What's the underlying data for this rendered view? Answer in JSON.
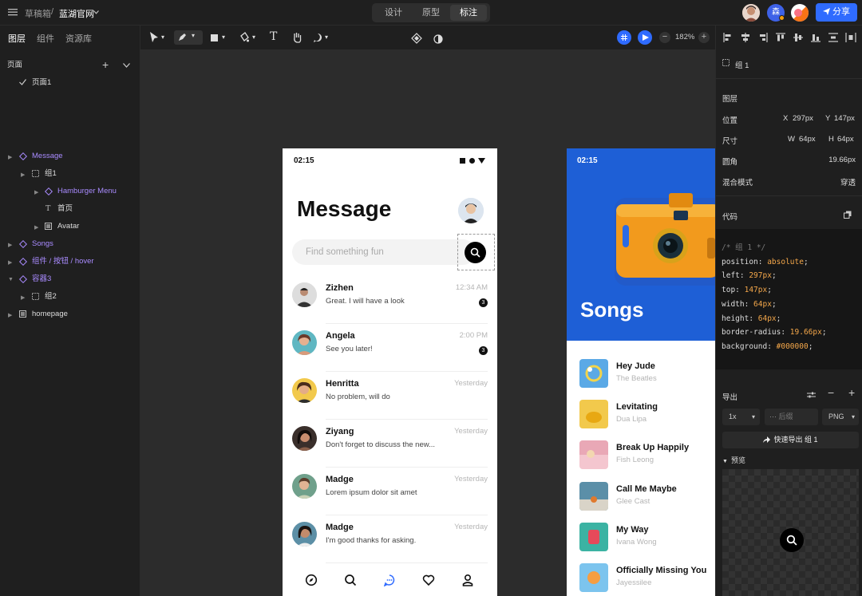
{
  "topbar": {
    "breadcrumb_root": "草稿箱",
    "breadcrumb_sep": "/",
    "project": "蓝湖官网",
    "modes": [
      "设计",
      "原型",
      "标注"
    ],
    "active_mode": "标注",
    "share_label": "分享"
  },
  "left_panel": {
    "tabs": [
      "图层",
      "组件",
      "资源库"
    ],
    "pages_label": "页面",
    "page_item": "页面1",
    "layers": [
      {
        "label": "Message"
      },
      {
        "label": "组1"
      },
      {
        "label": "Hamburger Menu"
      },
      {
        "label": "首页"
      },
      {
        "label": "Avatar"
      },
      {
        "label": "Songs"
      },
      {
        "label": "组件 / 按钮 / hover"
      },
      {
        "label": "容器3"
      },
      {
        "label": "组2"
      },
      {
        "label": "homepage"
      }
    ]
  },
  "toolbar": {
    "zoom": "182%"
  },
  "phone_message": {
    "time": "02:15",
    "title": "Message",
    "search_placeholder": "Find something fun",
    "rows": [
      {
        "name": "Zizhen",
        "text": "Great. I will have a look",
        "time": "12:34 AM",
        "badge": "3"
      },
      {
        "name": "Angela",
        "text": "See you later!",
        "time": "2:00 PM",
        "badge": "3"
      },
      {
        "name": "Henritta",
        "text": "No problem, will do",
        "time": "Yesterday"
      },
      {
        "name": "Ziyang",
        "text": "Don't forget to discuss the new...",
        "time": "Yesterday"
      },
      {
        "name": "Madge",
        "text": "Lorem ipsum dolor sit amet",
        "time": "Yesterday"
      },
      {
        "name": "Madge",
        "text": "I'm good thanks for asking.",
        "time": "Yesterday"
      }
    ]
  },
  "phone_songs": {
    "time": "02:15",
    "title": "Songs",
    "songs": [
      {
        "title": "Hey Jude",
        "artist": "The Beatles",
        "color": "#5aa9e6"
      },
      {
        "title": "Levitating",
        "artist": "Dua Lipa",
        "color": "#f2c94c"
      },
      {
        "title": "Break Up Happily",
        "artist": "Fish Leong",
        "color": "#f4c6cf"
      },
      {
        "title": "Call Me Maybe",
        "artist": "Glee Cast",
        "color": "#5b8fa8"
      },
      {
        "title": "My Way",
        "artist": "Ivana Wong",
        "color": "#3bb3a3"
      },
      {
        "title": "Officially Missing You",
        "artist": "Jayessilee",
        "color": "#f59e42"
      }
    ]
  },
  "inspector": {
    "layer_name": "组 1",
    "layer_section": "图层",
    "position_label": "位置",
    "x_label": "X",
    "x_value": "297px",
    "y_label": "Y",
    "y_value": "147px",
    "size_label": "尺寸",
    "w_label": "W",
    "w_value": "64px",
    "h_label": "H",
    "h_value": "64px",
    "radius_label": "圆角",
    "radius_value": "19.66px",
    "blend_label": "混合模式",
    "blend_value": "穿透",
    "code_label": "代码",
    "code_comment": "/* 组 1 */",
    "code_lines": [
      {
        "k": "position: ",
        "v": "absolute"
      },
      {
        "k": "left: ",
        "v": "297px"
      },
      {
        "k": "top: ",
        "v": "147px"
      },
      {
        "k": "width: ",
        "v": "64px"
      },
      {
        "k": "height: ",
        "v": "64px"
      },
      {
        "k": "border-radius: ",
        "v": "19.66px"
      },
      {
        "k": "background: ",
        "v": "#000000"
      }
    ],
    "export_label": "导出",
    "scale": "1x",
    "suffix_placeholder": "后缀",
    "format": "PNG",
    "export_button": "快速导出 组 1",
    "preview_label": "预览"
  },
  "colors": {
    "accent_blue": "#2f6bff",
    "layer_purple": "#a98bff",
    "code_value": "#f4a74a"
  }
}
